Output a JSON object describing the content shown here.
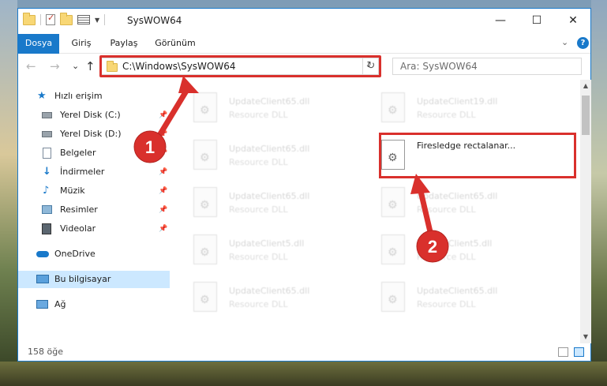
{
  "window": {
    "title": "SysWOW64"
  },
  "window_controls": {
    "minimize": "—",
    "maximize": "☐",
    "close": "✕"
  },
  "ribbon": {
    "tabs": [
      "Dosya",
      "Giriş",
      "Paylaş",
      "Görünüm"
    ],
    "expand": "⌄",
    "help": "?"
  },
  "nav": {
    "back": "←",
    "forward": "→",
    "recent": "⌄",
    "up": "↑"
  },
  "address": {
    "path": "C:\\Windows\\SysWOW64",
    "dropdown": "⌄",
    "refresh": "↻"
  },
  "search": {
    "placeholder": "Ara: SysWOW64"
  },
  "sidebar": {
    "items": [
      {
        "label": "Hızlı erişim",
        "icon": "star-icon"
      },
      {
        "label": "Yerel Disk (C:)",
        "icon": "drive-icon"
      },
      {
        "label": "Yerel Disk (D:)",
        "icon": "drive-icon"
      },
      {
        "label": "Belgeler",
        "icon": "documents-icon"
      },
      {
        "label": "İndirmeler",
        "icon": "download-icon"
      },
      {
        "label": "Müzik",
        "icon": "music-icon"
      },
      {
        "label": "Resimler",
        "icon": "pictures-icon"
      },
      {
        "label": "Videolar",
        "icon": "videos-icon"
      },
      {
        "label": "OneDrive",
        "icon": "cloud-icon"
      },
      {
        "label": "Bu bilgisayar",
        "icon": "computer-icon"
      },
      {
        "label": "Ağ",
        "icon": "network-icon"
      }
    ]
  },
  "files": [
    {
      "name": "UpdateClient65.dll",
      "type": "Resource DLL"
    },
    {
      "name": "UpdateClient19.dll",
      "type": "Resource DLL"
    },
    {
      "name": "UpdateClient65.dll",
      "type": "Resource DLL"
    },
    {
      "name": "Firesledge rectalanar...",
      "type": ""
    },
    {
      "name": "UpdateClient65.dll",
      "type": "Resource DLL"
    },
    {
      "name": "UpdateClient65.dll",
      "type": "Resource DLL"
    },
    {
      "name": "UpdateClient5.dll",
      "type": "Resource DLL"
    },
    {
      "name": "UpdateClient5.dll",
      "type": "Resource DLL"
    },
    {
      "name": "UpdateClient65.dll",
      "type": "Resource DLL"
    },
    {
      "name": "UpdateClient65.dll",
      "type": "Resource DLL"
    }
  ],
  "status": {
    "item_count": "158 öğe"
  },
  "annotations": {
    "step1": "1",
    "step2": "2"
  },
  "colors": {
    "accent": "#1979ca",
    "highlight": "#d9302c",
    "selected": "#cce8ff"
  }
}
